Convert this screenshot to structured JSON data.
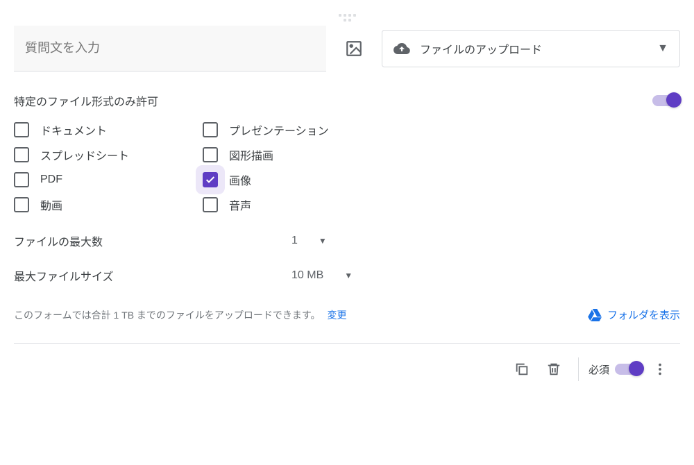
{
  "question": {
    "placeholder": "質問文を入力"
  },
  "typeSelector": {
    "label": "ファイルのアップロード"
  },
  "allowSpecific": {
    "label": "特定のファイル形式のみ許可",
    "enabled": true
  },
  "fileTypes": [
    {
      "label": "ドキュメント",
      "checked": false
    },
    {
      "label": "プレゼンテーション",
      "checked": false
    },
    {
      "label": "スプレッドシート",
      "checked": false
    },
    {
      "label": "図形描画",
      "checked": false
    },
    {
      "label": "PDF",
      "checked": false
    },
    {
      "label": "画像",
      "checked": true
    },
    {
      "label": "動画",
      "checked": false
    },
    {
      "label": "音声",
      "checked": false
    }
  ],
  "maxFiles": {
    "label": "ファイルの最大数",
    "value": "1"
  },
  "maxSize": {
    "label": "最大ファイルサイズ",
    "value": "10 MB"
  },
  "info": {
    "text": "このフォームでは合計 1 TB までのファイルをアップロードできます。",
    "changeLabel": "変更",
    "folderLabel": "フォルダを表示"
  },
  "footer": {
    "requiredLabel": "必須"
  }
}
